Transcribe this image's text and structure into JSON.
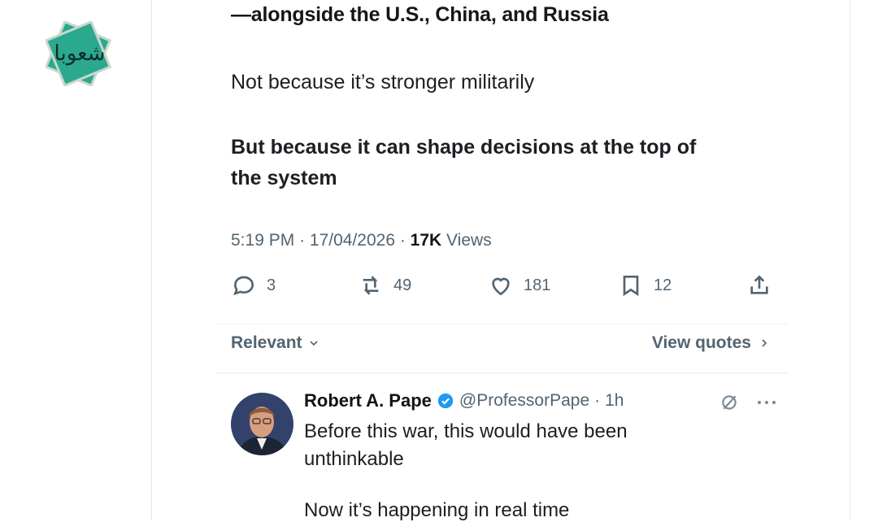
{
  "tweet": {
    "headline_tail": "—alongside the U.S., China, and Russia",
    "paragraph_1": "Not because it’s stronger militarily",
    "paragraph_2_line1": "But because it can shape decisions at the top of",
    "paragraph_2_line2": "the system",
    "time": "5:19 PM",
    "date": "17/04/2026",
    "views_count": "17K",
    "views_label": "Views"
  },
  "actions": {
    "reply_count": "3",
    "repost_count": "49",
    "like_count": "181",
    "bookmark_count": "12"
  },
  "filters": {
    "relevant_label": "Relevant",
    "view_quotes_label": "View quotes"
  },
  "reply": {
    "name": "Robert A. Pape",
    "handle": "@ProfessorPape",
    "time": "1h",
    "text_line1": "Before this war, this would have been",
    "text_line2": "unthinkable",
    "text_cut": "Now it’s happening in real time"
  },
  "logo": {
    "text": "شعوبا",
    "color": "#2aa98f"
  },
  "colors": {
    "muted": "#536471",
    "verified": "#1d9bf0"
  }
}
